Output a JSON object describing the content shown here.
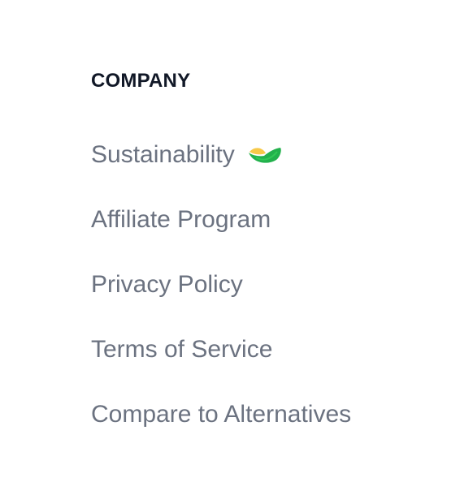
{
  "company": {
    "heading": "COMPANY",
    "links": [
      {
        "label": "Sustainability",
        "icon": "leaf-icon",
        "icon_colors": [
          "#f7c948",
          "#2ebd3a",
          "#22b14c"
        ]
      },
      {
        "label": "Affiliate Program"
      },
      {
        "label": "Privacy Policy"
      },
      {
        "label": "Terms of Service"
      },
      {
        "label": "Compare to Alternatives"
      }
    ]
  }
}
